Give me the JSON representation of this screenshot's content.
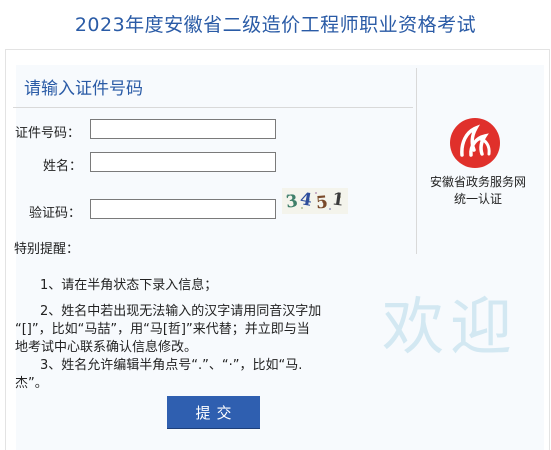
{
  "page": {
    "title": "2023年度安徽省二级造价工程师职业资格考试"
  },
  "form": {
    "heading": "请输入证件号码",
    "id_label": "证件号码：",
    "name_label": "姓名：",
    "captcha_label": "验证码：",
    "id_value": "",
    "name_value": "",
    "captcha_value": "",
    "captcha_text": [
      "3",
      "4",
      "5",
      "1"
    ],
    "notice_label": "特别提醒：",
    "submit_label": "提交"
  },
  "notes": {
    "n1": "1、请在半角状态下录入信息；",
    "n2a": "2、姓名中若出现无法输入的汉字请用同音汉字加",
    "n2b": "“[]”，比如“马喆”，用“马[哲]”来代替；并立即与当",
    "n2c": "地考试中心联系确认信息修改。",
    "n3a": "3、姓名允许编辑半角点号“.”、“·”，比如“马.",
    "n3b": "杰”。"
  },
  "org": {
    "line1": "安徽省政务服务网",
    "line2": "统一认证"
  },
  "watermark": {
    "text": "欢迎"
  },
  "colors": {
    "accent": "#2a5ba6",
    "button": "#2f5fb0",
    "logo": "#e0302b",
    "watermark": "#d3e8f2"
  },
  "icons": {
    "logo": "anhui-gov-service-logo"
  }
}
